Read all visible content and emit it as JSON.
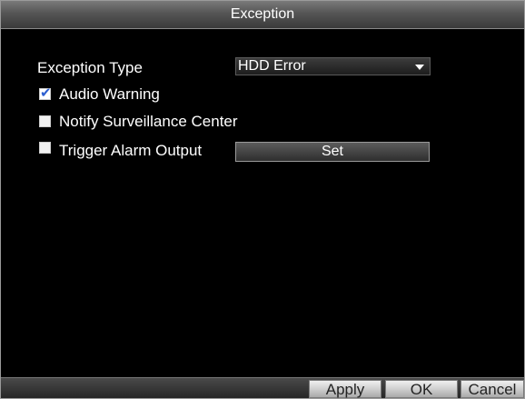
{
  "window": {
    "title": "Exception"
  },
  "form": {
    "exception_type_label": "Exception Type",
    "exception_type_value": "HDD Error",
    "audio_warning_label": "Audio Warning",
    "audio_warning_checked": true,
    "notify_center_label": "Notify Surveillance Center",
    "notify_center_checked": false,
    "trigger_alarm_label": "Trigger Alarm Output",
    "trigger_alarm_checked": false,
    "set_button_label": "Set"
  },
  "footer": {
    "apply_label": "Apply",
    "ok_label": "OK",
    "cancel_label": "Cancel"
  }
}
